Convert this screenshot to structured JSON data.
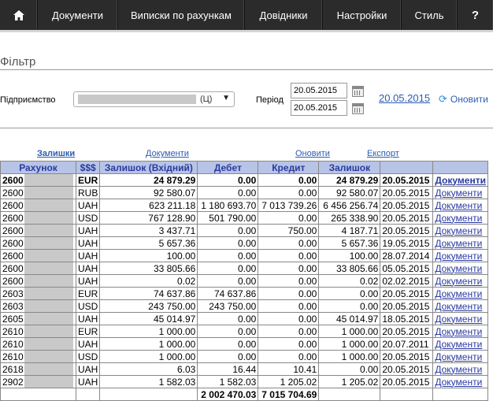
{
  "nav": {
    "items": [
      "Документи",
      "Виписки по рахункам",
      "Довідники",
      "Настройки",
      "Стиль"
    ],
    "help": "?"
  },
  "filter": {
    "title": "Фільтр",
    "enterprise_label": "Підприємство",
    "enterprise_value": "(Ц)",
    "period_label": "Період",
    "date_from": "20.05.2015",
    "date_to": "20.05.2015",
    "date_link": "20.05.2015",
    "refresh_label": "Оновити"
  },
  "table_links": {
    "balances": "Залишки",
    "documents": "Документи",
    "refresh": "Оновити",
    "export": "Експорт"
  },
  "table": {
    "headers": [
      "Рахунок",
      "$$$",
      "Залишок (Вхідний)",
      "Дебет",
      "Кредит",
      "Залишок",
      "",
      ""
    ],
    "rows": [
      {
        "acc": "2600",
        "cur": "EUR",
        "open": "24 879.29",
        "debit": "0.00",
        "credit": "0.00",
        "close": "24 879.29",
        "date": "20.05.2015",
        "link": "Документи"
      },
      {
        "acc": "2600",
        "cur": "RUB",
        "open": "92 580.07",
        "debit": "0.00",
        "credit": "0.00",
        "close": "92 580.07",
        "date": "20.05.2015",
        "link": "Документи"
      },
      {
        "acc": "2600",
        "cur": "UAH",
        "open": "623 211.18",
        "debit": "1 180 693.70",
        "credit": "7 013 739.26",
        "close": "6 456 256.74",
        "date": "20.05.2015",
        "link": "Документи"
      },
      {
        "acc": "2600",
        "cur": "USD",
        "open": "767 128.90",
        "debit": "501 790.00",
        "credit": "0.00",
        "close": "265 338.90",
        "date": "20.05.2015",
        "link": "Документи"
      },
      {
        "acc": "2600",
        "cur": "UAH",
        "open": "3 437.71",
        "debit": "0.00",
        "credit": "750.00",
        "close": "4 187.71",
        "date": "20.05.2015",
        "link": "Документи"
      },
      {
        "acc": "2600",
        "cur": "UAH",
        "open": "5 657.36",
        "debit": "0.00",
        "credit": "0.00",
        "close": "5 657.36",
        "date": "19.05.2015",
        "link": "Документи"
      },
      {
        "acc": "2600",
        "cur": "UAH",
        "open": "100.00",
        "debit": "0.00",
        "credit": "0.00",
        "close": "100.00",
        "date": "28.07.2014",
        "link": "Документи"
      },
      {
        "acc": "2600",
        "cur": "UAH",
        "open": "33 805.66",
        "debit": "0.00",
        "credit": "0.00",
        "close": "33 805.66",
        "date": "05.05.2015",
        "link": "Документи"
      },
      {
        "acc": "2600",
        "cur": "UAH",
        "open": "0.02",
        "debit": "0.00",
        "credit": "0.00",
        "close": "0.02",
        "date": "02.02.2015",
        "link": "Документи"
      },
      {
        "acc": "2603",
        "cur": "EUR",
        "open": "74 637.86",
        "debit": "74 637.86",
        "credit": "0.00",
        "close": "0.00",
        "date": "20.05.2015",
        "link": "Документи"
      },
      {
        "acc": "2603",
        "cur": "USD",
        "open": "243 750.00",
        "debit": "243 750.00",
        "credit": "0.00",
        "close": "0.00",
        "date": "20.05.2015",
        "link": "Документи"
      },
      {
        "acc": "2605",
        "cur": "UAH",
        "open": "45 014.97",
        "debit": "0.00",
        "credit": "0.00",
        "close": "45 014.97",
        "date": "18.05.2015",
        "link": "Документи"
      },
      {
        "acc": "2610",
        "cur": "EUR",
        "open": "1 000.00",
        "debit": "0.00",
        "credit": "0.00",
        "close": "1 000.00",
        "date": "20.05.2015",
        "link": "Документи"
      },
      {
        "acc": "2610",
        "cur": "UAH",
        "open": "1 000.00",
        "debit": "0.00",
        "credit": "0.00",
        "close": "1 000.00",
        "date": "20.07.2011",
        "link": "Документи"
      },
      {
        "acc": "2610",
        "cur": "USD",
        "open": "1 000.00",
        "debit": "0.00",
        "credit": "0.00",
        "close": "1 000.00",
        "date": "20.05.2015",
        "link": "Документи"
      },
      {
        "acc": "2618",
        "cur": "UAH",
        "open": "6.03",
        "debit": "16.44",
        "credit": "10.41",
        "close": "0.00",
        "date": "20.05.2015",
        "link": "Документи"
      },
      {
        "acc": "2902",
        "cur": "UAH",
        "open": "1 582.03",
        "debit": "1 582.03",
        "credit": "1 205.02",
        "close": "1 205.02",
        "date": "20.05.2015",
        "link": "Документи"
      }
    ],
    "totals": {
      "debit": "2 002 470.03",
      "credit": "7 015 704.69"
    }
  },
  "colors": {
    "nav_bg": "#2b2b2b",
    "header_bg": "#b7c4e6",
    "link": "#2a3aa0"
  }
}
